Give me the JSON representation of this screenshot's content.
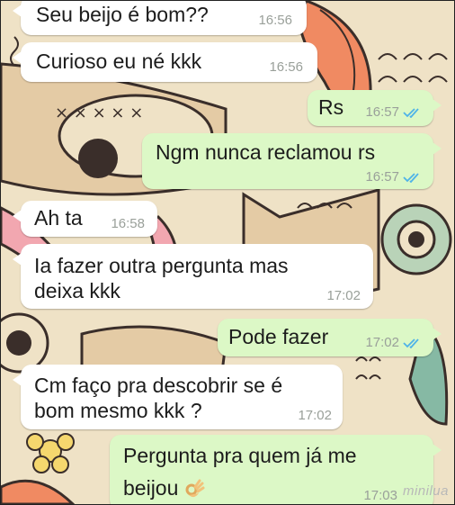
{
  "chat": {
    "messages": [
      {
        "direction": "incoming",
        "text": "Seu beijo é bom??",
        "time": "16:56"
      },
      {
        "direction": "incoming",
        "text": "Curioso eu né kkk",
        "time": "16:56"
      },
      {
        "direction": "outgoing",
        "text": "Rs",
        "time": "16:57",
        "status": "read"
      },
      {
        "direction": "outgoing",
        "text": "Ngm nunca reclamou rs",
        "time": "16:57",
        "status": "read"
      },
      {
        "direction": "incoming",
        "text": "Ah ta",
        "time": "16:58"
      },
      {
        "direction": "incoming",
        "lines": [
          "Ia fazer outra pergunta mas",
          "deixa kkk"
        ],
        "time": "17:02"
      },
      {
        "direction": "outgoing",
        "text": "Pode fazer",
        "time": "17:02",
        "status": "read"
      },
      {
        "direction": "incoming",
        "lines": [
          "Cm faço pra descobrir se é",
          "bom mesmo kkk ?"
        ],
        "time": "17:02"
      },
      {
        "direction": "outgoing",
        "lines": [
          "Pergunta pra quem já me",
          "beijou"
        ],
        "time": "17:03",
        "status": "read",
        "emoji": "ok-hand-emoji"
      }
    ]
  },
  "watermark": "minilua",
  "colors": {
    "incoming_bubble": "#ffffff",
    "outgoing_bubble": "#dcf8c6",
    "read_ticks": "#4fb3e8",
    "wallpaper": "#efe2c6"
  }
}
